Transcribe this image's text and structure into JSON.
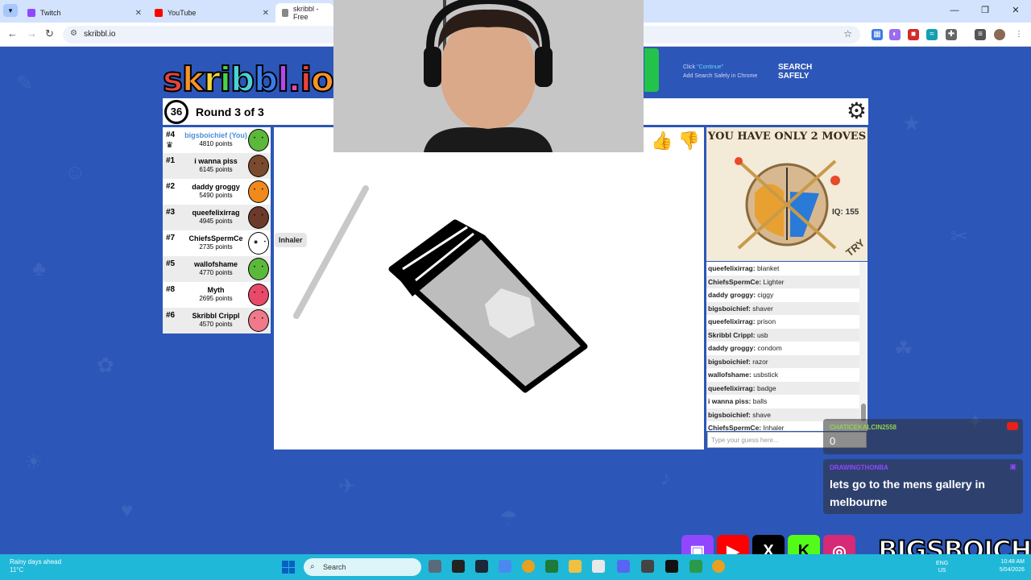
{
  "browser": {
    "tabs": [
      {
        "label": "Twitch",
        "color": "#9147ff"
      },
      {
        "label": "YouTube",
        "color": "#ff0000"
      },
      {
        "label": "skribbl - Free",
        "color": "#555555"
      }
    ],
    "url": "skribbl.io"
  },
  "ad_top": {
    "click_text": "Click",
    "continue_text": "\"Continue\"",
    "line2": "Add Search Safely in Chrome",
    "brand_line1": "SEARCH",
    "brand_line2": "SAFELY"
  },
  "game": {
    "logo": "skribbl.io",
    "timer": "36",
    "round": "Round 3 of 3",
    "tooltip": "Inhaler",
    "players": [
      {
        "rank": "#4",
        "name": "bigsboichief (You)",
        "points": "4810 points",
        "you": true,
        "avatar_color": "#5cb83a"
      },
      {
        "rank": "#1",
        "name": "i wanna piss",
        "points": "6145 points",
        "you": false,
        "avatar_color": "#7a4a2e"
      },
      {
        "rank": "#2",
        "name": "daddy groggy",
        "points": "5490 points",
        "you": false,
        "avatar_color": "#f08a1c"
      },
      {
        "rank": "#3",
        "name": "queefelixirrag",
        "points": "4945 points",
        "you": false,
        "avatar_color": "#6b3a2a"
      },
      {
        "rank": "#7",
        "name": "ChiefsSpermCe",
        "points": "2735 points",
        "you": false,
        "avatar_color": "#ffffff"
      },
      {
        "rank": "#5",
        "name": "wallofshame",
        "points": "4770 points",
        "you": false,
        "avatar_color": "#5cb83a"
      },
      {
        "rank": "#8",
        "name": "Myth",
        "points": "2695 points",
        "you": false,
        "avatar_color": "#e84a6a"
      },
      {
        "rank": "#6",
        "name": "Skribbl Crippl",
        "points": "4570 points",
        "you": false,
        "avatar_color": "#f07a8a"
      }
    ]
  },
  "ad_side": {
    "headline": "YOU HAVE ONLY 2 MOVES",
    "iq": "IQ: 155",
    "cta": "TRY"
  },
  "chat": {
    "messages": [
      {
        "user": "queefelixirrag:",
        "text": "blanket"
      },
      {
        "user": "ChiefsSpermCe:",
        "text": "Lighter"
      },
      {
        "user": "daddy groggy:",
        "text": "ciggy"
      },
      {
        "user": "bigsboichief:",
        "text": "shaver"
      },
      {
        "user": "queefelixirrag:",
        "text": "prison"
      },
      {
        "user": "Skribbl Crippl:",
        "text": "usb"
      },
      {
        "user": "daddy groggy:",
        "text": "condom"
      },
      {
        "user": "bigsboichief:",
        "text": "razor"
      },
      {
        "user": "wallofshame:",
        "text": "usbstick"
      },
      {
        "user": "queefelixirrag:",
        "text": "badge"
      },
      {
        "user": "i wanna piss:",
        "text": "balls"
      },
      {
        "user": "bigsboichief:",
        "text": "shave"
      },
      {
        "user": "ChiefsSpermCe:",
        "text": "Inhaler"
      }
    ],
    "input_placeholder": "Type your guess here..."
  },
  "stream_overlay": {
    "msg1_user": "CHATICEKALCIN2558",
    "msg1_text": "0",
    "msg2_user": "DRAWINGTHONBA",
    "msg2_text": "lets go to the mens gallery in melbourne",
    "handle": "BIGSBOICHIEF"
  },
  "taskbar": {
    "weather_line1": "Rainy days ahead",
    "weather_line2": "11°C",
    "search": "Search",
    "lang1": "ENG",
    "lang2": "US",
    "time": "10:48 AM",
    "date": "5/04/2026"
  },
  "colors": {
    "page_bg": "#2c56b8",
    "taskbar": "#20b8d8",
    "you_name": "#4a90d9"
  }
}
